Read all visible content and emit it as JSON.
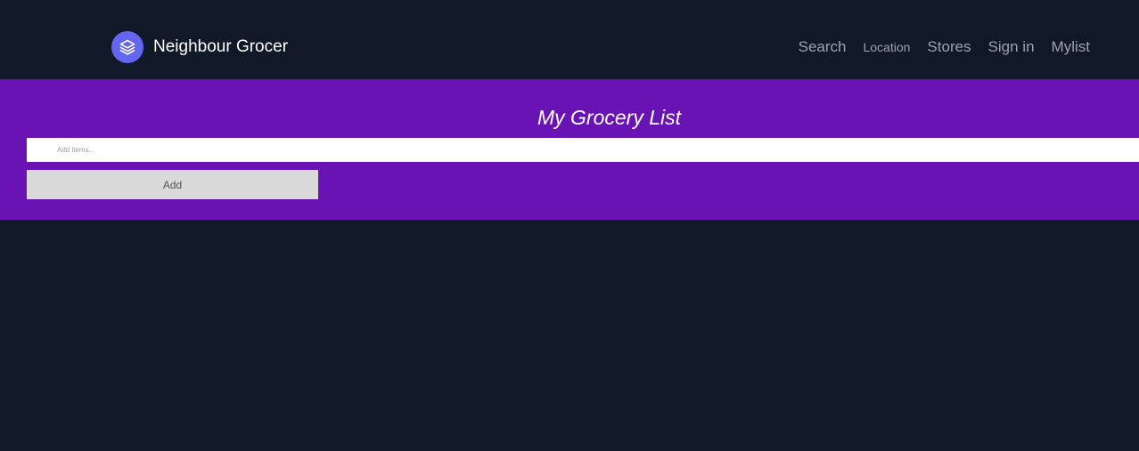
{
  "brand": {
    "name": "Neighbour Grocer",
    "logo_icon": "layers-icon",
    "logo_color": "#6366f1"
  },
  "nav": {
    "items": [
      {
        "label": "Search"
      },
      {
        "label": "Location"
      },
      {
        "label": "Stores"
      },
      {
        "label": "Sign in"
      },
      {
        "label": "Mylist"
      }
    ]
  },
  "grocery_list": {
    "title": "My Grocery List",
    "input_placeholder": "Add items...",
    "input_value": "",
    "add_label": "Add"
  },
  "colors": {
    "background": "#111827",
    "banner": "#6a13b5",
    "nav_text": "#9ca3af",
    "button": "#d9d9d9"
  }
}
